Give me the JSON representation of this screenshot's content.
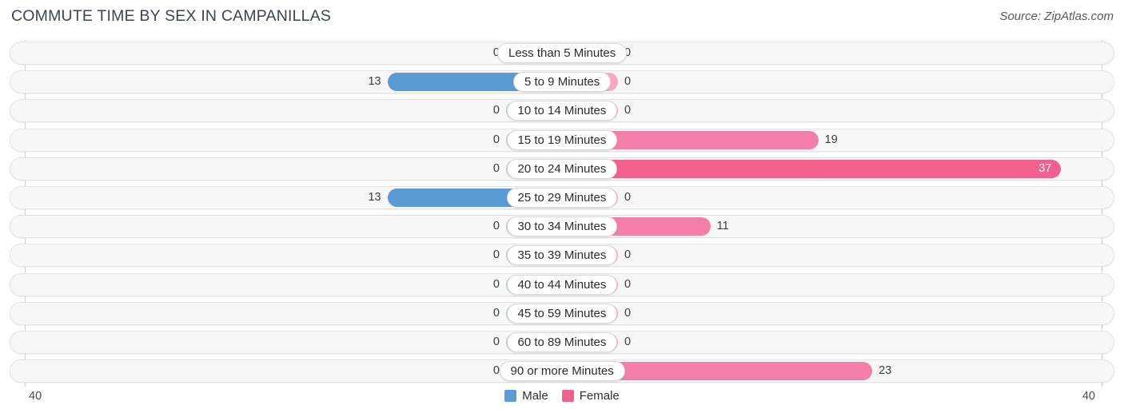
{
  "header": {
    "title": "COMMUTE TIME BY SEX IN CAMPANILLAS",
    "source": "Source: ZipAtlas.com"
  },
  "axis": {
    "left_label": "40",
    "right_label": "40"
  },
  "legend": {
    "items": [
      {
        "label": "Male",
        "color": "#5b9bd5"
      },
      {
        "label": "Female",
        "color": "#f4608e"
      }
    ]
  },
  "colors": {
    "male": "#5b9bd5",
    "male_zero": "#a9c8ec",
    "female": "#f4608e",
    "female_zero": "#f9a8c4",
    "female_mid": "#f37fa8",
    "track": "#f7f7f7",
    "track_border": "#e3e3e3"
  },
  "chart_data": {
    "type": "bar",
    "subtype": "diverging-horizontal-butterfly",
    "title": "COMMUTE TIME BY SEX IN CAMPANILLAS",
    "source": "Source: ZipAtlas.com",
    "xlabel": "",
    "ylabel": "",
    "xlim": [
      40,
      40
    ],
    "axis_max_left": 40,
    "axis_max_right": 40,
    "grid": false,
    "legend_position": "bottom-center",
    "categories": [
      "Less than 5 Minutes",
      "5 to 9 Minutes",
      "10 to 14 Minutes",
      "15 to 19 Minutes",
      "20 to 24 Minutes",
      "25 to 29 Minutes",
      "30 to 34 Minutes",
      "35 to 39 Minutes",
      "40 to 44 Minutes",
      "45 to 59 Minutes",
      "60 to 89 Minutes",
      "90 or more Minutes"
    ],
    "series": [
      {
        "name": "Male",
        "side": "left",
        "color": "#5b9bd5",
        "values": [
          0,
          13,
          0,
          0,
          0,
          13,
          0,
          0,
          0,
          0,
          0,
          0
        ]
      },
      {
        "name": "Female",
        "side": "right",
        "color": "#f4608e",
        "values": [
          0,
          0,
          0,
          19,
          37,
          0,
          11,
          0,
          0,
          0,
          0,
          23
        ]
      }
    ],
    "rows": [
      {
        "category": "Less than 5 Minutes",
        "male": "0",
        "female": "0"
      },
      {
        "category": "5 to 9 Minutes",
        "male": "13",
        "female": "0"
      },
      {
        "category": "10 to 14 Minutes",
        "male": "0",
        "female": "0"
      },
      {
        "category": "15 to 19 Minutes",
        "male": "0",
        "female": "19"
      },
      {
        "category": "20 to 24 Minutes",
        "male": "0",
        "female": "37"
      },
      {
        "category": "25 to 29 Minutes",
        "male": "13",
        "female": "0"
      },
      {
        "category": "30 to 34 Minutes",
        "male": "0",
        "female": "11"
      },
      {
        "category": "35 to 39 Minutes",
        "male": "0",
        "female": "0"
      },
      {
        "category": "40 to 44 Minutes",
        "male": "0",
        "female": "0"
      },
      {
        "category": "45 to 59 Minutes",
        "male": "0",
        "female": "0"
      },
      {
        "category": "60 to 89 Minutes",
        "male": "0",
        "female": "0"
      },
      {
        "category": "90 or more Minutes",
        "male": "0",
        "female": "23"
      }
    ]
  }
}
